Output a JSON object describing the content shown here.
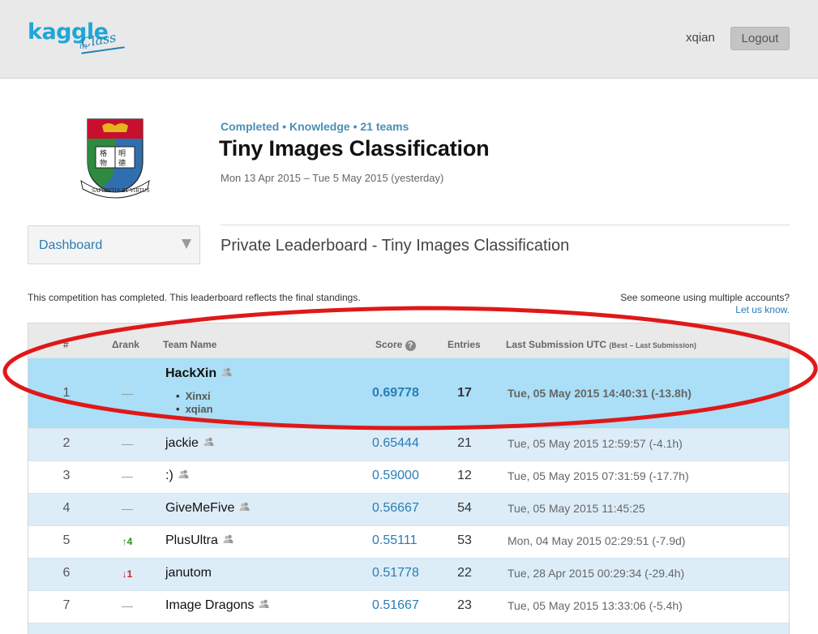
{
  "header": {
    "logo_main": "kaggle",
    "logo_in": "in",
    "logo_class": "Class",
    "username": "xqian",
    "logout_label": "Logout"
  },
  "competition": {
    "status_line": "Completed • Knowledge • 21 teams",
    "title": "Tiny Images Classification",
    "dates": "Mon 13 Apr 2015 – Tue 5 May 2015 (yesterday)",
    "crest_motto": "SAPIENTIA ET VIRTUS",
    "crest_chars": [
      "明",
      "德",
      "格",
      "物"
    ]
  },
  "nav": {
    "dashboard_label": "Dashboard"
  },
  "leaderboard": {
    "title": "Private Leaderboard - Tiny Images Classification",
    "notice": "This competition has completed. This leaderboard reflects the final standings.",
    "multi_accounts": "See someone using multiple accounts?",
    "let_us_know": "Let us know.",
    "columns": {
      "rank": "#",
      "delta": "Δrank",
      "team": "Team Name",
      "score": "Score",
      "entries": "Entries",
      "last": "Last Submission UTC",
      "last_note": "(Best – Last Submission)"
    },
    "rows": [
      {
        "rank": "1",
        "delta": "—",
        "team": "HackXin",
        "score": "0.69778",
        "entries": "17",
        "last": "Tue, 05 May 2015 14:40:31 (-13.8h)",
        "members": [
          "Xinxi",
          "xqian"
        ]
      },
      {
        "rank": "2",
        "delta": "—",
        "team": "jackie",
        "score": "0.65444",
        "entries": "21",
        "last": "Tue, 05 May 2015 12:59:57 (-4.1h)"
      },
      {
        "rank": "3",
        "delta": "—",
        "team": ":)",
        "score": "0.59000",
        "entries": "12",
        "last": "Tue, 05 May 2015 07:31:59 (-17.7h)"
      },
      {
        "rank": "4",
        "delta": "—",
        "team": "GiveMeFive",
        "score": "0.56667",
        "entries": "54",
        "last": "Tue, 05 May 2015 11:45:25"
      },
      {
        "rank": "5",
        "delta": "↑4",
        "team": "PlusUltra",
        "score": "0.55111",
        "entries": "53",
        "last": "Mon, 04 May 2015 02:29:51 (-7.9d)"
      },
      {
        "rank": "6",
        "delta": "↓1",
        "team": "janutom",
        "score": "0.51778",
        "entries": "22",
        "last": "Tue, 28 Apr 2015 00:29:34 (-29.4h)"
      },
      {
        "rank": "7",
        "delta": "—",
        "team": "Image Dragons",
        "score": "0.51667",
        "entries": "23",
        "last": "Tue, 05 May 2015 13:33:06 (-5.4h)"
      }
    ]
  },
  "colors": {
    "brand": "#20a6d8",
    "link": "#2a7db3",
    "highlight_row": "#aadff7",
    "alt_row": "#dcedf8",
    "annotation": "#e01818"
  }
}
